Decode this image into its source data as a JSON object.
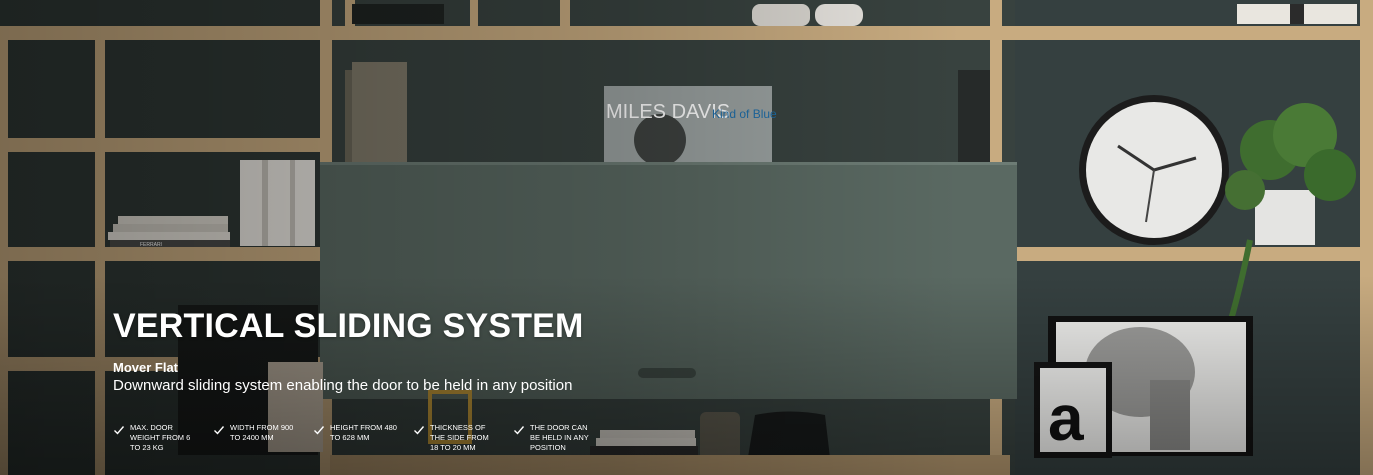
{
  "hero": {
    "title": "VERTICAL SLIDING SYSTEM",
    "subtitle": "Mover Flat",
    "description": "Downward sliding system enabling the door to be held in any position",
    "record_cover": {
      "artist": "MILES DAVIS",
      "album": "Kind of Blue"
    },
    "book_spine": "FERRARI",
    "poster_letter": "a",
    "features": [
      {
        "icon": "check-icon",
        "text": "MAX. DOOR WEIGHT FROM 6 TO 23 KG"
      },
      {
        "icon": "check-icon",
        "text": "WIDTH FROM 900 TO 2400 MM"
      },
      {
        "icon": "check-icon",
        "text": "HEIGHT FROM 480 TO 628 MM"
      },
      {
        "icon": "check-icon",
        "text": "THICKNESS OF THE SIDE FROM 18 TO 20 MM"
      },
      {
        "icon": "check-icon",
        "text": "THE DOOR CAN BE HELD IN ANY POSITION"
      }
    ]
  },
  "colors": {
    "wall": "#3b4541",
    "shelf_wood": "#c9ad82",
    "door_panel": "#57675f",
    "text": "#ffffff"
  }
}
